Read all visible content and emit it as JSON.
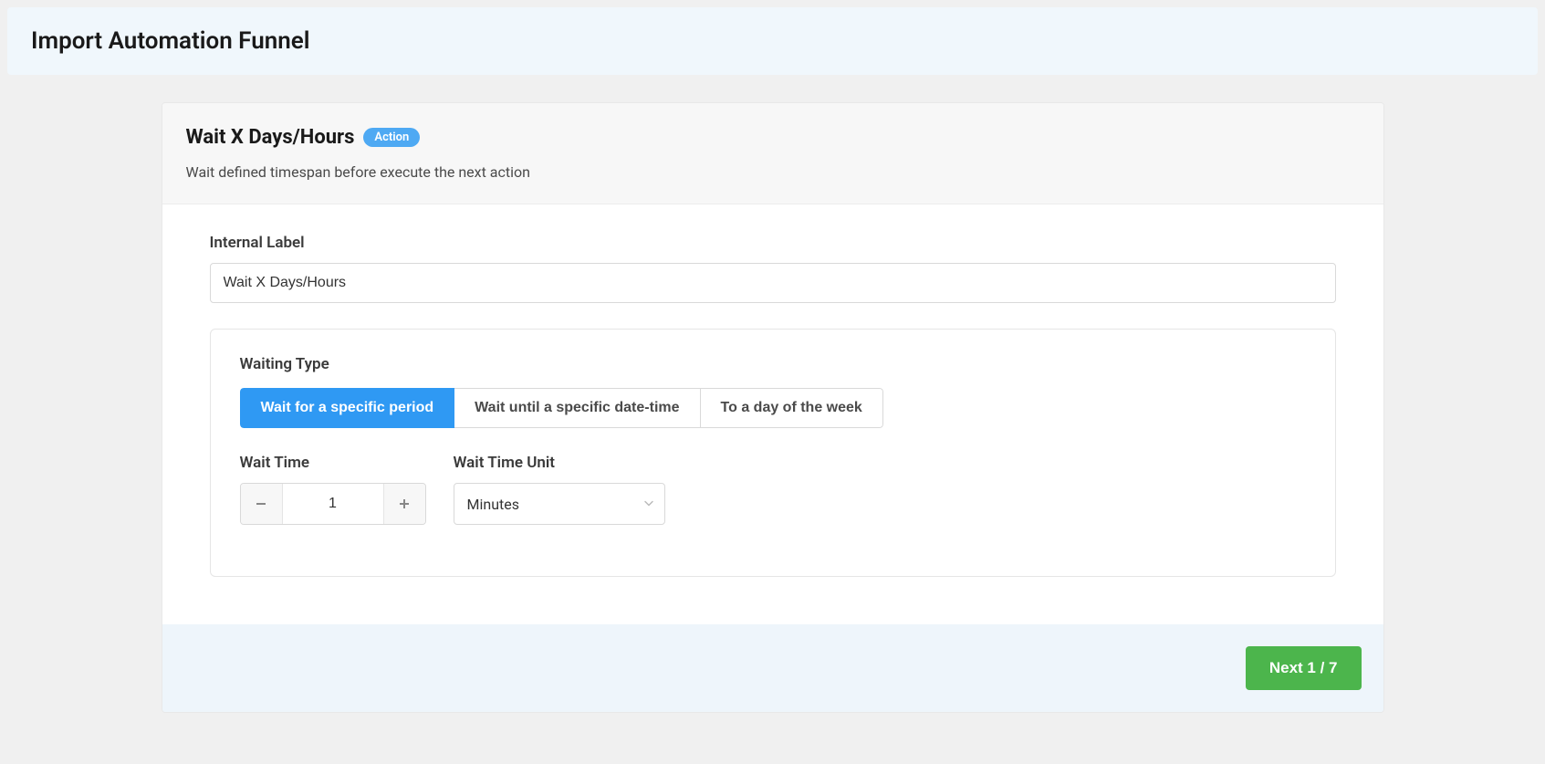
{
  "header": {
    "title": "Import Automation Funnel"
  },
  "card": {
    "title": "Wait X Days/Hours",
    "badge": "Action",
    "subtitle": "Wait defined timespan before execute the next action"
  },
  "form": {
    "internal_label": {
      "label": "Internal Label",
      "value": "Wait X Days/Hours"
    },
    "waiting_type": {
      "label": "Waiting Type",
      "options": [
        "Wait for a specific period",
        "Wait until a specific date-time",
        "To a day of the week"
      ],
      "selected_index": 0
    },
    "wait_time": {
      "label": "Wait Time",
      "value": "1"
    },
    "wait_time_unit": {
      "label": "Wait Time Unit",
      "value": "Minutes"
    }
  },
  "footer": {
    "next_label": "Next 1 / 7"
  }
}
